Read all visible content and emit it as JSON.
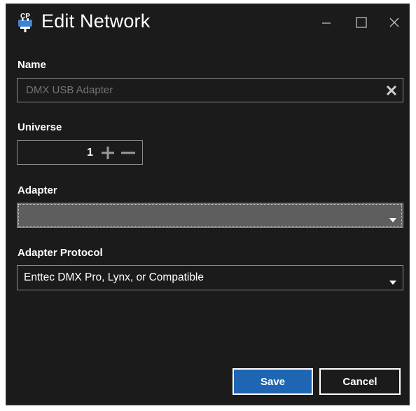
{
  "window": {
    "title": "Edit Network",
    "app_icon": "cp-plug-icon",
    "app_icon_text": "CP",
    "controls": {
      "minimize": "minimize-icon",
      "maximize": "maximize-icon",
      "close": "close-icon"
    }
  },
  "form": {
    "name": {
      "label": "Name",
      "value": "",
      "placeholder": "DMX USB Adapter",
      "clear_icon": "clear-x-icon"
    },
    "universe": {
      "label": "Universe",
      "value": "1",
      "increment_icon": "plus-icon",
      "decrement_icon": "minus-icon"
    },
    "adapter": {
      "label": "Adapter",
      "selected": ""
    },
    "adapter_protocol": {
      "label": "Adapter Protocol",
      "selected": "Enttec DMX Pro, Lynx, or Compatible"
    }
  },
  "actions": {
    "save_label": "Save",
    "cancel_label": "Cancel"
  },
  "colors": {
    "background": "#1b1b1b",
    "accent": "#1e66b3",
    "border": "#8a8a8a",
    "focused_select": "#5e5e5e"
  }
}
